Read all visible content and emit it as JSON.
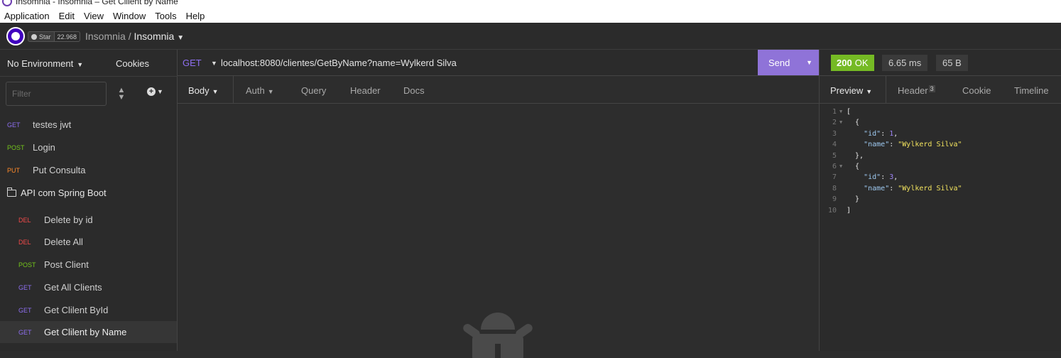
{
  "window": {
    "title": "Insomnia - Insomnia – Get Clilent by Name"
  },
  "menu": [
    "Application",
    "Edit",
    "View",
    "Window",
    "Tools",
    "Help"
  ],
  "header": {
    "star_label": "Star",
    "star_count": "22.968",
    "breadcrumb_parent": "Insomnia",
    "breadcrumb_sep": "/",
    "breadcrumb_current": "Insomnia"
  },
  "sidebar": {
    "environment": "No Environment",
    "cookies": "Cookies",
    "filter_placeholder": "Filter",
    "requests_top": [
      {
        "method": "GET",
        "name": "testes jwt"
      },
      {
        "method": "POST",
        "name": "Login"
      },
      {
        "method": "PUT",
        "name": "Put Consulta"
      }
    ],
    "folder": "API com Spring Boot",
    "requests_folder": [
      {
        "method": "DEL",
        "name": "Delete by id"
      },
      {
        "method": "DEL",
        "name": "Delete All"
      },
      {
        "method": "POST",
        "name": "Post Client"
      },
      {
        "method": "GET",
        "name": "Get All Clients"
      },
      {
        "method": "GET",
        "name": "Get Clilent ById"
      },
      {
        "method": "GET",
        "name": "Get Clilent by Name"
      }
    ]
  },
  "request": {
    "method": "GET",
    "url": "localhost:8080/clientes/GetByName?name=Wylkerd Silva",
    "send_label": "Send",
    "tabs": {
      "body": "Body",
      "auth": "Auth",
      "query": "Query",
      "header": "Header",
      "docs": "Docs"
    }
  },
  "response": {
    "status_code": "200",
    "status_text": "OK",
    "time": "6.65 ms",
    "size": "65 B",
    "tabs": {
      "preview": "Preview",
      "header": "Header",
      "header_count": "3",
      "cookie": "Cookie",
      "timeline": "Timeline"
    },
    "body_lines": [
      {
        "n": "1",
        "text": "["
      },
      {
        "n": "2",
        "text": "  {"
      },
      {
        "n": "3",
        "text": "    \"id\": 1,"
      },
      {
        "n": "4",
        "text": "    \"name\": \"Wylkerd Silva\""
      },
      {
        "n": "5",
        "text": "  },"
      },
      {
        "n": "6",
        "text": "  {"
      },
      {
        "n": "7",
        "text": "    \"id\": 3,"
      },
      {
        "n": "8",
        "text": "    \"name\": \"Wylkerd Silva\""
      },
      {
        "n": "9",
        "text": "  }"
      },
      {
        "n": "10",
        "text": "]"
      }
    ]
  },
  "colors": {
    "accent": "#8f73d8",
    "status_ok": "#75ba24",
    "method_get": "#8e6ff0",
    "method_post": "#74c51b",
    "method_put": "#ff8a2a",
    "method_del": "#f24a4a"
  }
}
